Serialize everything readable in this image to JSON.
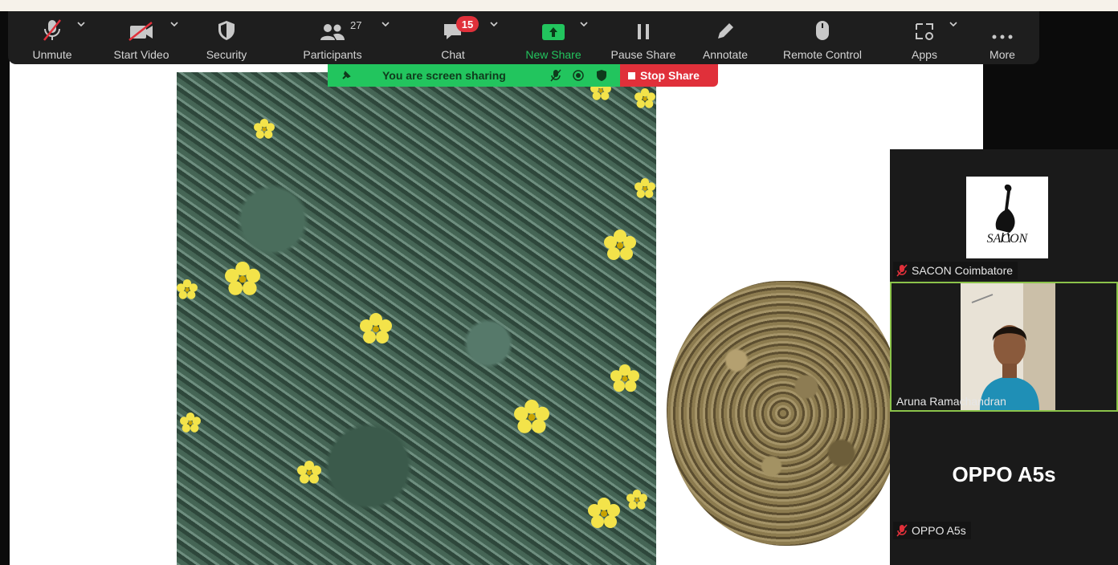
{
  "toolbar": {
    "unmute_label": "Unmute",
    "start_video_label": "Start Video",
    "security_label": "Security",
    "participants_label": "Participants",
    "participants_count": "27",
    "chat_label": "Chat",
    "chat_badge": "15",
    "new_share_label": "New Share",
    "pause_share_label": "Pause Share",
    "annotate_label": "Annotate",
    "remote_control_label": "Remote Control",
    "apps_label": "Apps",
    "more_label": "More"
  },
  "sharing": {
    "status_text": "You are screen sharing",
    "stop_label": "Stop Share"
  },
  "participants": [
    {
      "name": "SACON Coimbatore",
      "muted": true,
      "logo_text": "SACON"
    },
    {
      "name": "Aruna Ramachandran",
      "muted": false,
      "active_speaker": true
    },
    {
      "name": "OPPO A5s",
      "muted": true,
      "display_name": "OPPO A5s"
    }
  ],
  "colors": {
    "toolbar_bg": "#1e1e1e",
    "share_green": "#22c55e",
    "stop_red": "#e0303a",
    "active_border": "#8bc34a"
  }
}
